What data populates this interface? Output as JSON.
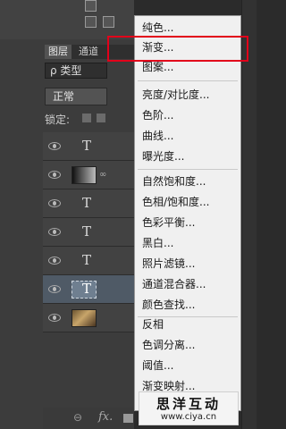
{
  "layers_panel": {
    "tabs": [
      "图层",
      "通道"
    ],
    "kind_filter": "ρ 类型",
    "blend_mode": "正常",
    "lock_label": "锁定:",
    "layers": [
      {
        "type": "text",
        "glyph": "T",
        "selected": false
      },
      {
        "type": "gradient",
        "glyph": "",
        "selected": false
      },
      {
        "type": "text",
        "glyph": "T",
        "selected": false
      },
      {
        "type": "text",
        "glyph": "T",
        "selected": false
      },
      {
        "type": "text",
        "glyph": "T",
        "selected": false
      },
      {
        "type": "text",
        "glyph": "T",
        "selected": true
      },
      {
        "type": "photo",
        "glyph": "",
        "selected": false
      }
    ],
    "bottom_fx": "fx."
  },
  "menu": {
    "items": [
      "纯色...",
      "渐变...",
      "图案...",
      "亮度/对比度...",
      "色阶...",
      "曲线...",
      "曝光度...",
      "自然饱和度...",
      "色相/饱和度...",
      "色彩平衡...",
      "黑白...",
      "照片滤镜...",
      "通道混合器...",
      "颜色查找...",
      "反相",
      "色调分离...",
      "阈值...",
      "渐变映射..."
    ],
    "highlighted_item": "渐变...",
    "highlight_color": "#e2001a"
  },
  "watermark": {
    "title": "思洋互动",
    "url": "www.ciya.cn"
  }
}
